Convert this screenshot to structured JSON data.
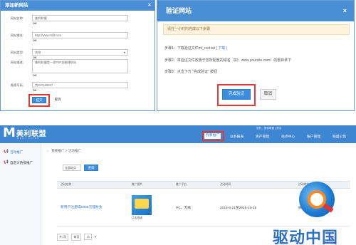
{
  "dialog_add": {
    "title": "添加新网站",
    "close": "×",
    "fields": [
      {
        "label": "网站名称:",
        "value": "美利联盟"
      },
      {
        "label": "网站域名:",
        "value": "http://www.mljlr.com"
      },
      {
        "label": "网站类型:",
        "value": "其他"
      },
      {
        "label": "网站描述:",
        "value": "美利联盟是一家P2P金融理财站"
      },
      {
        "label": "备案号码:",
        "value": "京ICP120037"
      }
    ],
    "ok_mark": "OK",
    "submit_label": "提交",
    "cancel_label": "取消"
  },
  "dialog_verify": {
    "title": "验证网站",
    "close": "×",
    "notice": "请在一小时内完成以下步骤",
    "step1_prefix": "步骤1：下载验证文件ml_root.txt",
    "step1_link": "[ 下载 ]",
    "step2": "步骤2：将验证文件放置于您所配置的域名（如：www.yoursite.com）的根目录下",
    "step3_prefix": "步骤3：点击下方",
    "step3_quote": "\"完成验证\"",
    "step3_suffix": "按钮",
    "confirm_label": "完成验证",
    "cancel_label": "取消"
  },
  "site": {
    "brand": "美利联盟",
    "brand_sub": "MEILI UNION",
    "user_info": "您好，美利联盟  |  退出",
    "nav": [
      "我要推广",
      "业务报表",
      "资产管理",
      "站点中心",
      "账户管理",
      "联盟公告"
    ],
    "nav_active_index": 0,
    "side": [
      {
        "label": "活动推广",
        "active": true
      },
      {
        "label": "自定义链接推广",
        "active": false
      }
    ],
    "breadcrumb_root": "我要推广",
    "breadcrumb_sep": ">",
    "breadcrumb_leaf": "活动推广",
    "filter_value": "全部站点",
    "filter_button": "查询",
    "table_headers": [
      "活动名称",
      "推广图片",
      "推广平台",
      "活动时间",
      "活动状态"
    ],
    "rows": [
      {
        "name": "新用户注册得8888元理财金",
        "image_caption": "点击推送",
        "platform": "PC、无线",
        "time": "2015-9-21至2015-10-15",
        "status": "执行中"
      }
    ],
    "pager_total": "共1页",
    "pager_per": "每页",
    "pager_size": "10"
  },
  "watermark": "驱动中国",
  "accent": "#3f86d2",
  "highlight": "#e53935"
}
